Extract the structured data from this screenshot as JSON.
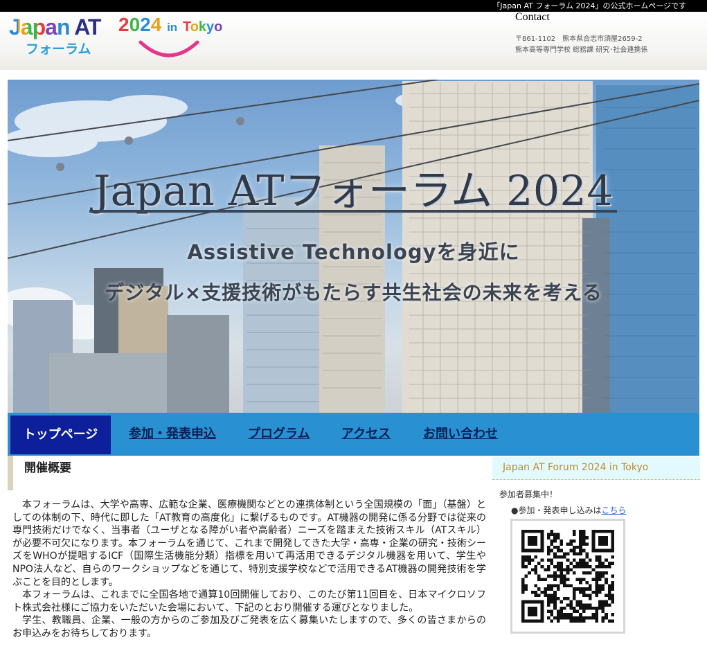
{
  "topbar": {
    "text": "「Japan AT フォーラム 2024」の公式ホームページです"
  },
  "logo": {
    "japan": "Japan",
    "at": "AT",
    "forum": "フォーラム",
    "year": "2024",
    "in": "in",
    "tokyo": "Tokyo"
  },
  "contact": {
    "title": "Contact",
    "address": "〒861-1102　熊本県合志市須屋2659-2",
    "department": "熊本高等専門学校 総務課 研究･社会連携係"
  },
  "hero": {
    "title": "Japan ATフォーラム 2024",
    "subtitle": "Assistive Technologyを身近に",
    "tagline": "デジタル×支援技術がもたらす共生社会の未来を考える"
  },
  "nav": {
    "items": [
      {
        "label": "トップページ"
      },
      {
        "label": "参加・発表申込"
      },
      {
        "label": "プログラム"
      },
      {
        "label": "アクセス"
      },
      {
        "label": "お問い合わせ"
      }
    ],
    "active_index": 0
  },
  "main": {
    "heading": "開催概要",
    "paragraphs": [
      "本フォーラムは、大学や高専、広範な企業、医療機関などとの連携体制という全国規模の「面」（基盤）としての体制の下、時代に即した「AT教育の高度化」に繋げるものです。AT機器の開発に係る分野では従来の専門技術だけでなく、当事者（ユーザとなる障がい者や高齢者）ニーズを踏まえた技術スキル（ATスキル）が必要不可欠になります。本フォーラムを通じて、これまで開発してきた大学・高専・企業の研究・技術シーズをWHOが提唱するICF（国際生活機能分類）指標を用いて再活用できるデジタル機器を用いて、学生やNPO法人など、自らのワークショップなどを通じて、特別支援学校などで活用できるAT機器の開発技術を学ぶことを目的とします。",
      "本フォーラムは、これまでに全国各地で通算10回開催しており、このたび第11回目を、日本マイクロソフト株式会社様にご協力をいただいた会場において、下記のとおり開催する運びとなりました。",
      "学生、教職員、企業、一般の方からのご参加及びご発表を広く募集いたしますので、多くの皆さまからのお申込みをお待ちしております。"
    ]
  },
  "sidebar": {
    "heading": "Japan AT Forum 2024 in Tokyo",
    "recruit": "参加者募集中！",
    "apply_prefix": "●参加・発表申し込みは",
    "apply_link": "こちら",
    "qr_icon": "qr-code"
  },
  "colors": {
    "nav_bg": "#2991d2",
    "nav_active": "#0d1f9a",
    "nav_text": "#0a1f55",
    "sidebar_head_bg": "#e2fafe",
    "sidebar_head_text": "#c08a26",
    "logo_smile": "#e6358c"
  }
}
